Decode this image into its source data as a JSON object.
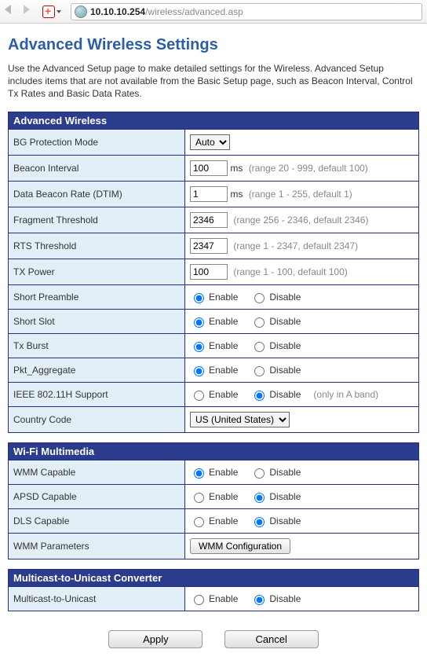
{
  "url": {
    "host": "10.10.10.254",
    "path": "/wireless/advanced.asp"
  },
  "page": {
    "title": "Advanced Wireless Settings",
    "intro": "Use the Advanced Setup page to make detailed settings for the Wireless. Advanced Setup includes items that are not available from the Basic Setup page, such as Beacon Interval, Control Tx Rates and Basic Data Rates."
  },
  "sections": {
    "advanced": {
      "header": "Advanced Wireless",
      "bg_label": "BG Protection Mode",
      "bg_value": "Auto",
      "beacon_label": "Beacon Interval",
      "beacon_value": "100",
      "beacon_unit": "ms",
      "beacon_hint": "(range 20 - 999, default 100)",
      "dtim_label": "Data Beacon Rate (DTIM)",
      "dtim_value": "1",
      "dtim_unit": "ms",
      "dtim_hint": "(range 1 - 255, default 1)",
      "frag_label": "Fragment Threshold",
      "frag_value": "2346",
      "frag_hint": "(range 256 - 2346, default 2346)",
      "rts_label": "RTS Threshold",
      "rts_value": "2347",
      "rts_hint": "(range 1 - 2347, default 2347)",
      "txp_label": "TX Power",
      "txp_value": "100",
      "txp_hint": "(range 1 - 100, default 100)",
      "short_preamble_label": "Short Preamble",
      "short_slot_label": "Short Slot",
      "tx_burst_label": "Tx Burst",
      "pkt_agg_label": "Pkt_Aggregate",
      "ieee_label": "IEEE 802.11H Support",
      "ieee_hint": "(only in A band)",
      "country_label": "Country Code",
      "country_value": "US (United States)",
      "enable_text": "Enable",
      "disable_text": "Disable"
    },
    "wmm": {
      "header": "Wi-Fi Multimedia",
      "wmm_label": "WMM Capable",
      "apsd_label": "APSD Capable",
      "dls_label": "DLS Capable",
      "params_label": "WMM Parameters",
      "params_button": "WMM Configuration"
    },
    "m2u": {
      "header": "Multicast-to-Unicast Converter",
      "label": "Multicast-to-Unicast"
    }
  },
  "buttons": {
    "apply": "Apply",
    "cancel": "Cancel"
  },
  "radios": {
    "short_preamble": "enable",
    "short_slot": "enable",
    "tx_burst": "enable",
    "pkt_agg": "enable",
    "ieee": "disable",
    "wmm": "enable",
    "apsd": "disable",
    "dls": "disable",
    "m2u": "disable"
  }
}
